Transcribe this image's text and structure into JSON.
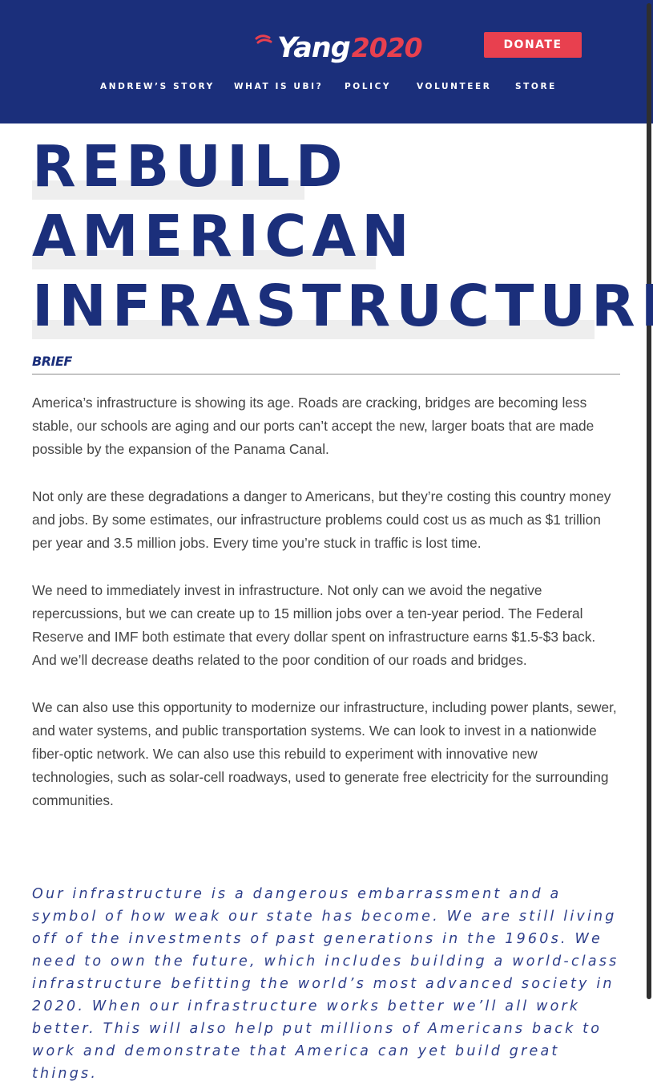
{
  "header": {
    "logo": {
      "name": "Yang",
      "year": "2020"
    },
    "donate_label": "DONATE",
    "nav": [
      {
        "label": "ANDREW’S STORY"
      },
      {
        "label": "WHAT IS UBI?"
      },
      {
        "label": "POLICY"
      },
      {
        "label": "VOLUNTEER"
      },
      {
        "label": "STORE"
      }
    ]
  },
  "page": {
    "title_lines": [
      "REBUILD",
      "AMERICAN",
      "INFRASTRUCTURE"
    ],
    "section_label": "BRIEF",
    "paragraphs": [
      "America’s infrastructure is showing its age. Roads are cracking, bridges are becoming less stable, our schools are aging and our ports can’t accept the new, larger boats that are made possible by the expansion of the Panama Canal.",
      "Not only are these degradations a danger to Americans, but they’re costing this country money and jobs.  By some estimates, our infrastructure problems could cost us as much as $1 trillion per year and 3.5 million jobs.  Every time you’re stuck in traffic is lost time.",
      "We need to immediately invest in infrastructure. Not only can we avoid the negative repercussions, but we can create up to 15 million jobs over a ten-year period. The Federal Reserve and IMF both estimate that every dollar spent on infrastructure earns $1.5-$3 back. And we’ll decrease deaths related to the poor condition of our roads and bridges.",
      "We can also use this opportunity to modernize our infrastructure, including power plants, sewer, and water systems, and public transportation systems. We can look to invest in a nationwide fiber-optic network. We can also use this rebuild to experiment with innovative new technologies, such as solar-cell roadways, used to generate free electricity for the surrounding communities."
    ],
    "quote": "Our infrastructure is a dangerous embarrassment and a symbol of how weak our state has become. We are still living off of the investments of past generations in the 1960s. We need to own the future, which includes building a world-class infrastructure befitting the world’s most advanced society in 2020. When our infrastructure works better we’ll all work better. This will also help put millions of Americans back to work and demonstrate that America can yet build great things."
  },
  "colors": {
    "navy": "#1b2f7b",
    "red": "#e8404f",
    "body_text": "#444444"
  }
}
